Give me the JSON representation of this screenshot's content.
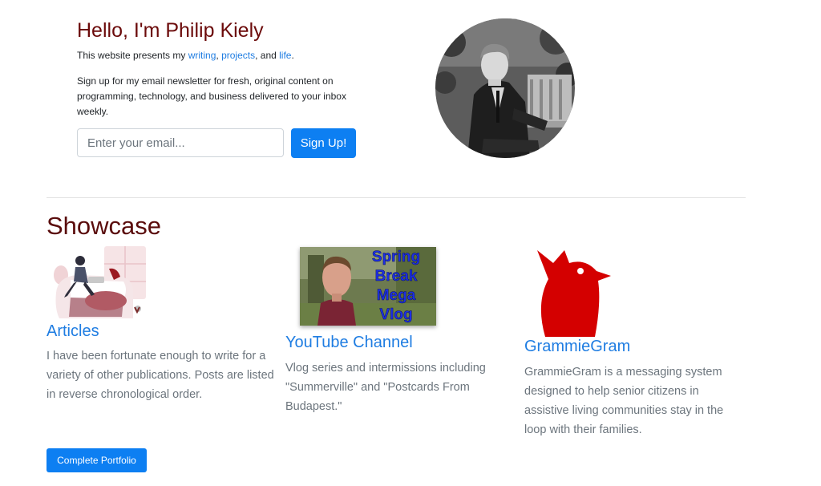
{
  "hero": {
    "title": "Hello, I'm Philip Kiely",
    "intro_prefix": "This website presents my ",
    "links": [
      "writing",
      "projects",
      "life"
    ],
    "sep1": ", ",
    "sep2": ", and ",
    "suffix": ".",
    "signup_text": "Sign up for my email newsletter for fresh, original content on programming, technology, and business delivered to your inbox weekly.",
    "email_placeholder": "Enter your email...",
    "signup_button": "Sign Up!"
  },
  "showcase": {
    "title": "Showcase",
    "cards": [
      {
        "title": "Articles",
        "text": "I have been fortunate enough to write for a variety of other publications. Posts are listed in reverse chronological order.",
        "image": "person-at-desk-illustration"
      },
      {
        "title": "YouTube Channel",
        "text": "Vlog series and intermissions including \"Summerville\" and \"Postcards From Budapest.\"",
        "image": "vlog-thumbnail",
        "thumbnail_text": [
          "Spring",
          "Break",
          "Mega",
          "Vlog"
        ]
      },
      {
        "title": "GrammieGram",
        "text": "GrammieGram is a messaging system designed to help senior citizens in assistive living communities stay in the loop with their families.",
        "image": "red-bird-logo"
      }
    ],
    "portfolio_button": "Complete Portfolio"
  },
  "colors": {
    "heading": "#6b0a0a",
    "link": "#1f7de2",
    "button": "#0d7ff2",
    "logo_red": "#d40000"
  }
}
